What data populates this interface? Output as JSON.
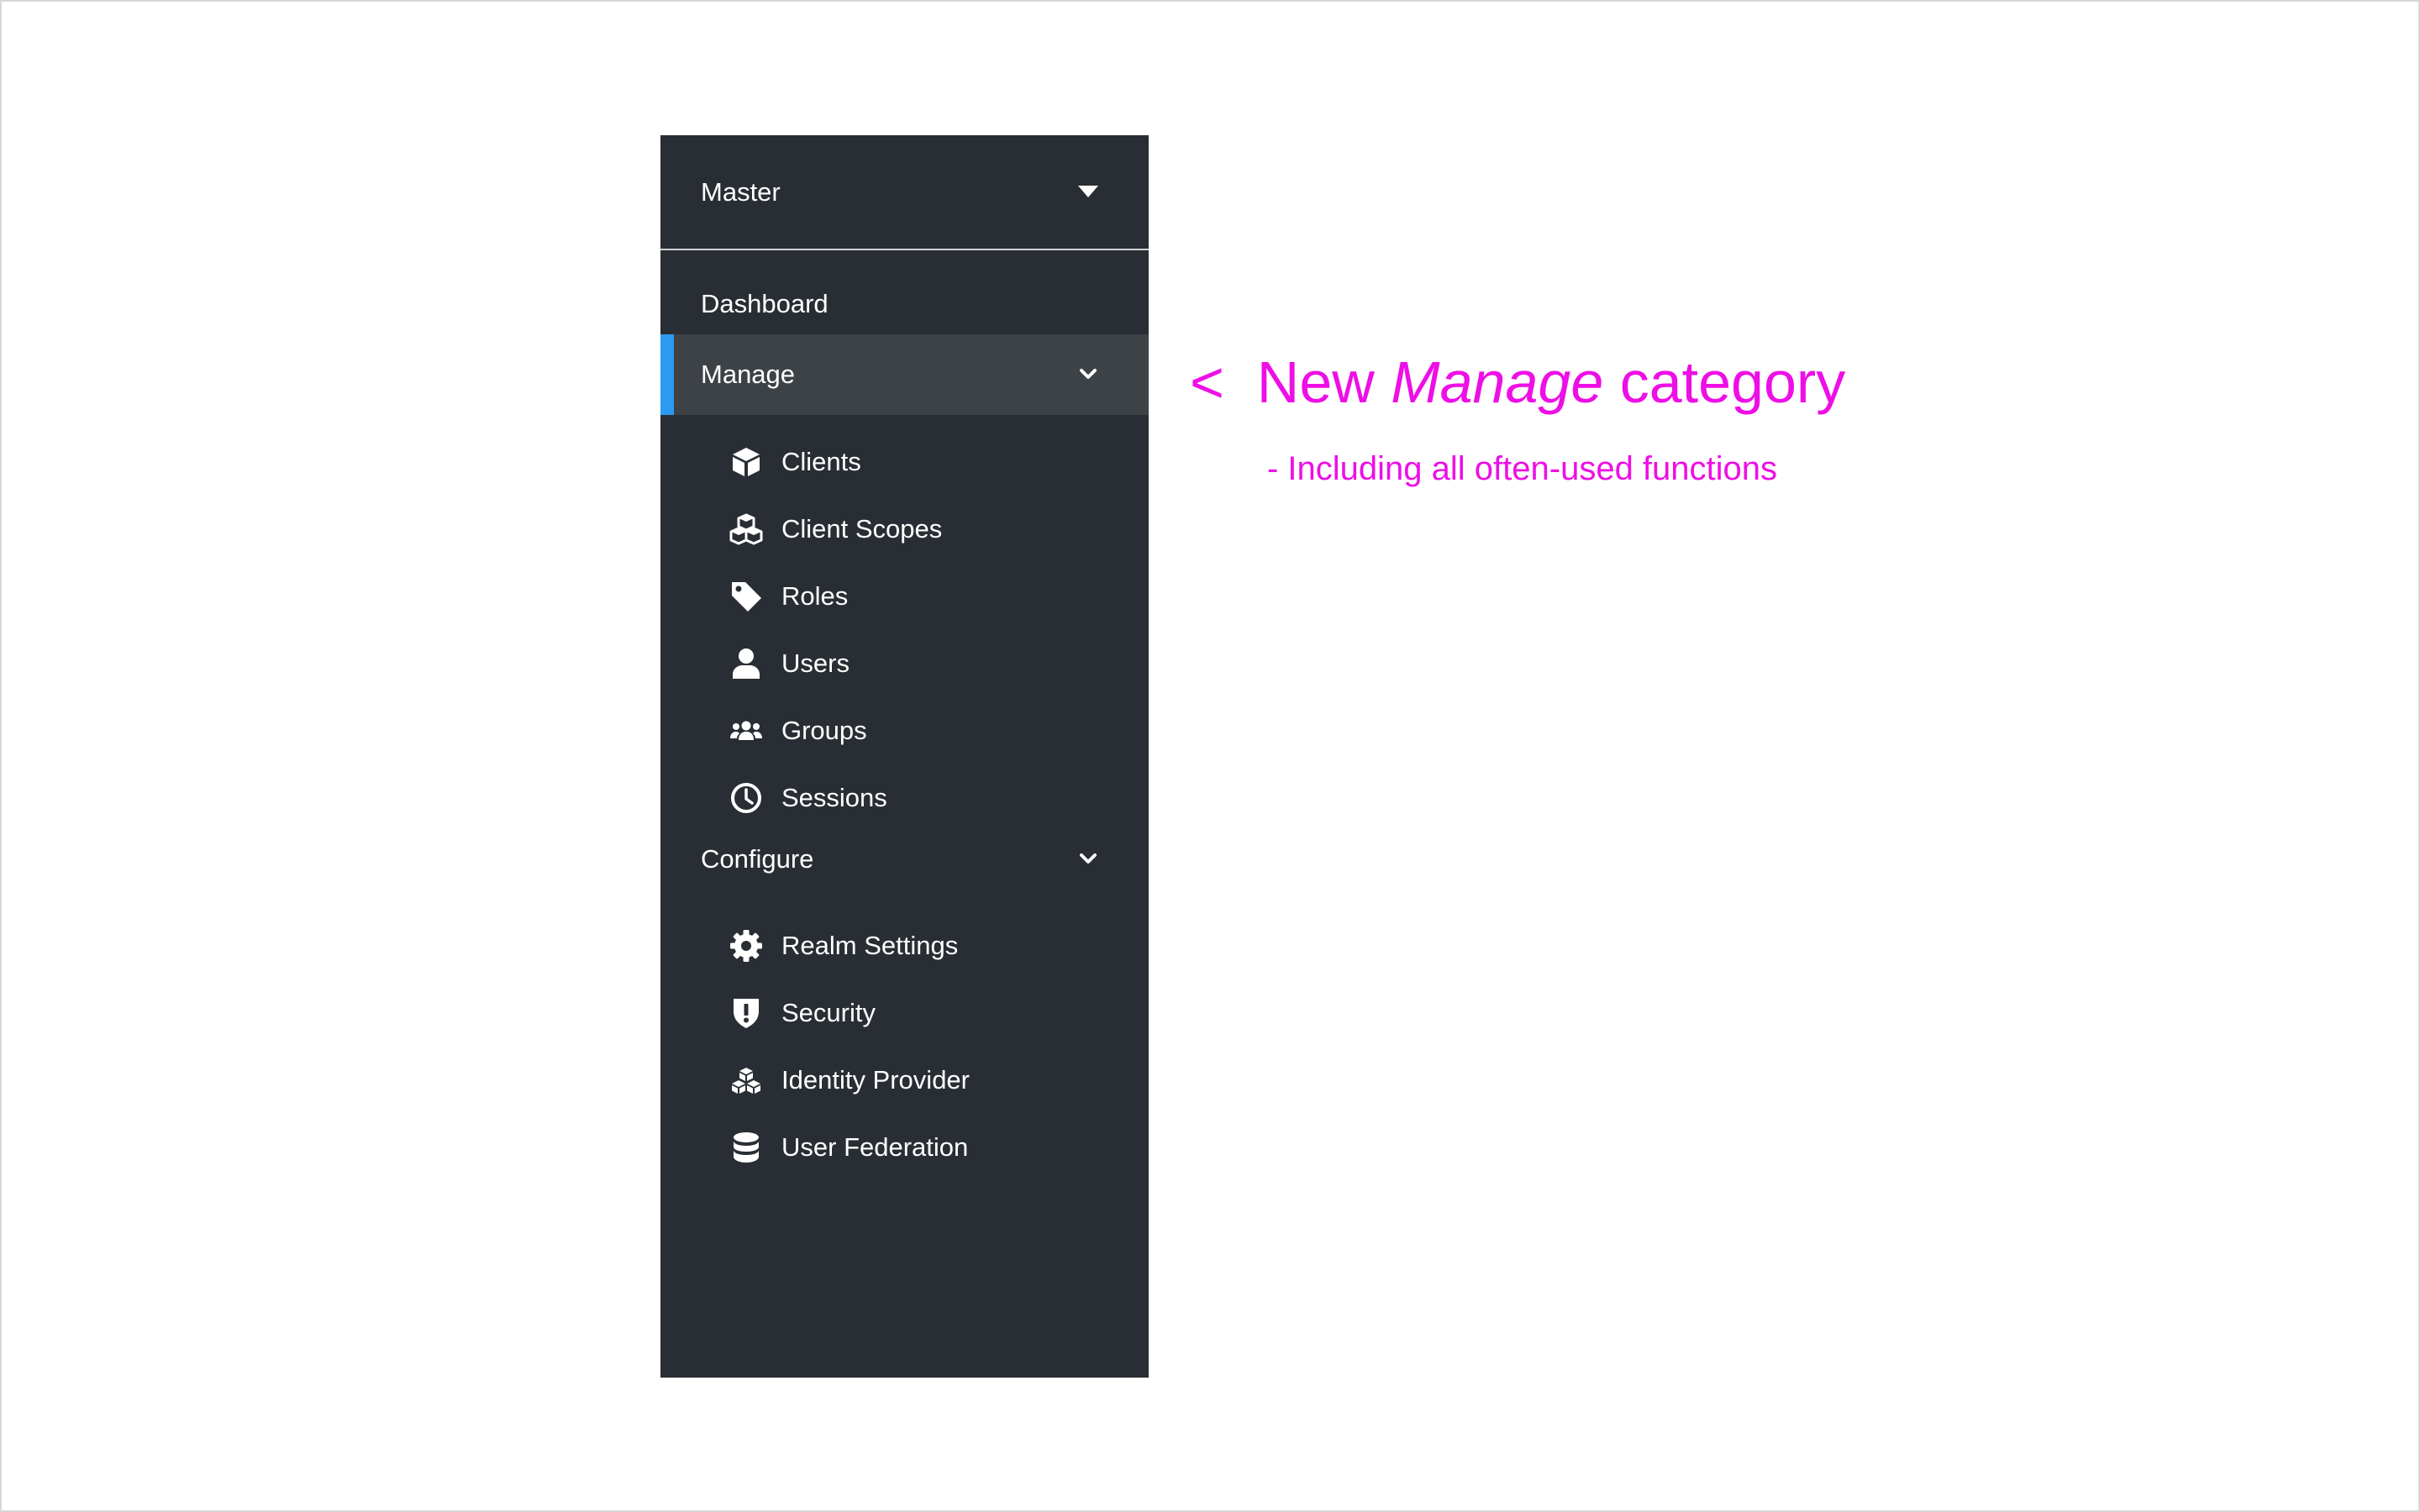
{
  "sidebar": {
    "realm_selector": {
      "label": "Master",
      "icon": "caret-down-icon"
    },
    "dashboard": {
      "label": "Dashboard"
    },
    "manage": {
      "label": "Manage",
      "icon": "chevron-down-icon",
      "active": true,
      "items": [
        {
          "label": "Clients",
          "icon": "cube-icon"
        },
        {
          "label": "Client Scopes",
          "icon": "cubes-icon"
        },
        {
          "label": "Roles",
          "icon": "tag-icon"
        },
        {
          "label": "Users",
          "icon": "user-icon"
        },
        {
          "label": "Groups",
          "icon": "users-icon"
        },
        {
          "label": "Sessions",
          "icon": "clock-icon"
        }
      ]
    },
    "configure": {
      "label": "Configure",
      "icon": "chevron-down-icon",
      "items": [
        {
          "label": "Realm Settings",
          "icon": "gear-icon"
        },
        {
          "label": "Security",
          "icon": "shield-alert-icon"
        },
        {
          "label": "Identity Provider",
          "icon": "cubes-stacked-icon"
        },
        {
          "label": "User Federation",
          "icon": "database-icon"
        }
      ]
    }
  },
  "annotation": {
    "arrow": "<",
    "title_prefix": "New",
    "title_emphasis": "Manage",
    "title_suffix": "category",
    "subtitle": "- Including all often-used functions"
  },
  "colors": {
    "sidebar_bg": "#292e34",
    "active_item_bg": "#3d4247",
    "active_accent": "#2b9af3",
    "annotation": "#ee0ee6",
    "text": "#ffffff"
  }
}
